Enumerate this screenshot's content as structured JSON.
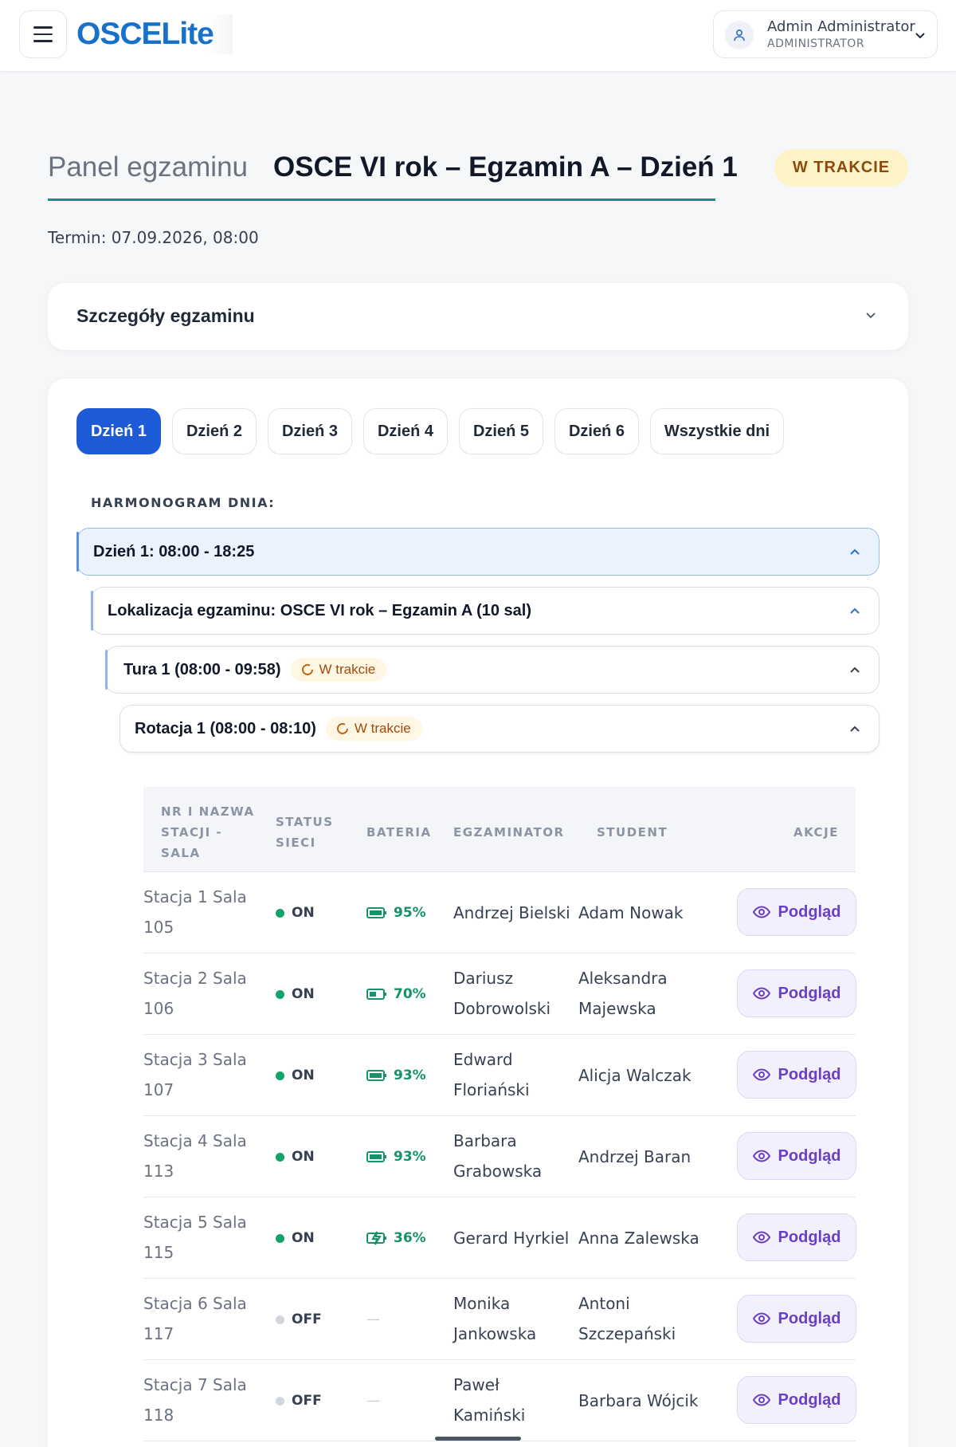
{
  "header": {
    "logo_text": "OSCELite",
    "user_name": "Admin Administrator",
    "user_role": "ADMINISTRATOR"
  },
  "page": {
    "panel_label": "Panel egzaminu",
    "exam_title": "OSCE VI rok – Egzamin A – Dzień 1",
    "status": "W TRAKCIE",
    "term": "Termin: 07.09.2026, 08:00"
  },
  "details": {
    "title": "Szczegóły egzaminu"
  },
  "tabs": [
    "Dzień 1",
    "Dzień 2",
    "Dzień 3",
    "Dzień 4",
    "Dzień 5",
    "Dzień 6",
    "Wszystkie dni"
  ],
  "active_tab": "Dzień 1",
  "schedule": {
    "label": "HARMONOGRAM DNIA:",
    "day": "Dzień 1: 08:00 - 18:25",
    "location": "Lokalizacja egzaminu: OSCE VI rok – Egzamin A (10 sal)",
    "tour": "Tura 1 (08:00 - 09:58)",
    "tour_status": "W trakcie",
    "rotation": "Rotacja 1 (08:00 - 08:10)",
    "rotation_status": "W trakcie"
  },
  "table": {
    "headers": {
      "station": [
        "NR I NAZWA",
        "STACJI -",
        "SALA"
      ],
      "network": [
        "STATUS",
        "SIECI"
      ],
      "battery": "BATERIA",
      "examiner": "EGZAMINATOR",
      "student": "STUDENT",
      "actions": "AKCJE"
    },
    "view_label": "Podgląd",
    "rows": [
      {
        "station": [
          "Stacja 1  Sala",
          "105"
        ],
        "network": "ON",
        "battery": "95%",
        "battery_icon": "battery-full-icon",
        "examiner": [
          "Andrzej Bielski"
        ],
        "student": [
          "Adam Nowak"
        ]
      },
      {
        "station": [
          "Stacja 2  Sala",
          "106"
        ],
        "network": "ON",
        "battery": "70%",
        "battery_icon": "battery-half-icon",
        "examiner": [
          "Dariusz",
          "Dobrowolski"
        ],
        "student": [
          "Aleksandra",
          "Majewska"
        ]
      },
      {
        "station": [
          "Stacja 3  Sala",
          "107"
        ],
        "network": "ON",
        "battery": "93%",
        "battery_icon": "battery-full-icon",
        "examiner": [
          "Edward",
          "Floriański"
        ],
        "student": [
          "Alicja Walczak"
        ]
      },
      {
        "station": [
          "Stacja 4  Sala",
          "113"
        ],
        "network": "ON",
        "battery": "93%",
        "battery_icon": "battery-full-icon",
        "examiner": [
          "Barbara",
          "Grabowska"
        ],
        "student": [
          "Andrzej Baran"
        ]
      },
      {
        "station": [
          "Stacja 5  Sala",
          "115"
        ],
        "network": "ON",
        "battery": "36%",
        "battery_icon": "battery-charging-icon",
        "examiner": [
          "Gerard Hyrkiel"
        ],
        "student": [
          "Anna Zalewska"
        ]
      },
      {
        "station": [
          "Stacja 6  Sala",
          "117"
        ],
        "network": "OFF",
        "battery": "—",
        "battery_icon": "",
        "examiner": [
          "Monika",
          "Jankowska"
        ],
        "student": [
          "Antoni",
          "Szczepański"
        ]
      },
      {
        "station": [
          "Stacja 7  Sala",
          "118"
        ],
        "network": "OFF",
        "battery": "—",
        "battery_icon": "",
        "examiner": [
          "Paweł",
          "Kamiński"
        ],
        "student": [
          "Barbara Wójcik"
        ]
      }
    ]
  },
  "colors": {
    "brand": "#1771c9",
    "active_tab": "#1d5ad8",
    "status_pill_bg": "#fef3c7",
    "online": "#10a36a",
    "offline": "#cfd6de",
    "view_button": "#6b3fc4"
  }
}
